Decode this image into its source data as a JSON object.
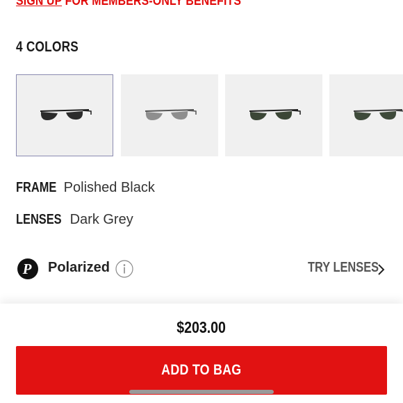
{
  "promo": {
    "link_text": "SIGN UP",
    "rest_text": " FOR MEMBERS-ONLY BENEFITS",
    "color": "#e10a0a"
  },
  "colors": {
    "heading": "4 COLORS",
    "swatches": [
      {
        "name": "polished-black-dark-grey",
        "frame": "#1e1e1e",
        "lens": "#2b2b2b",
        "selected": true
      },
      {
        "name": "gunmetal-silver-mirror",
        "frame": "#555555",
        "lens": "#8e8e8e",
        "selected": false
      },
      {
        "name": "black-green",
        "frame": "#1e1e1e",
        "lens": "#3b4636",
        "selected": false
      },
      {
        "name": "gunmetal-green",
        "frame": "#3a3a3a",
        "lens": "#3e4a3a",
        "selected": false
      }
    ]
  },
  "frame": {
    "label": "FRAME",
    "value": "Polished Black"
  },
  "lenses": {
    "label": "LENSES",
    "value": "Dark Grey"
  },
  "polarized": {
    "label": "Polarized",
    "icon": "polarized-p-icon",
    "info_icon": "info-icon"
  },
  "try_lenses": {
    "label": "TRY LENSES",
    "icon": "chevron-right-icon"
  },
  "price": "$203.00",
  "add_to_bag": {
    "label": "ADD TO BAG",
    "color": "#e11212"
  }
}
